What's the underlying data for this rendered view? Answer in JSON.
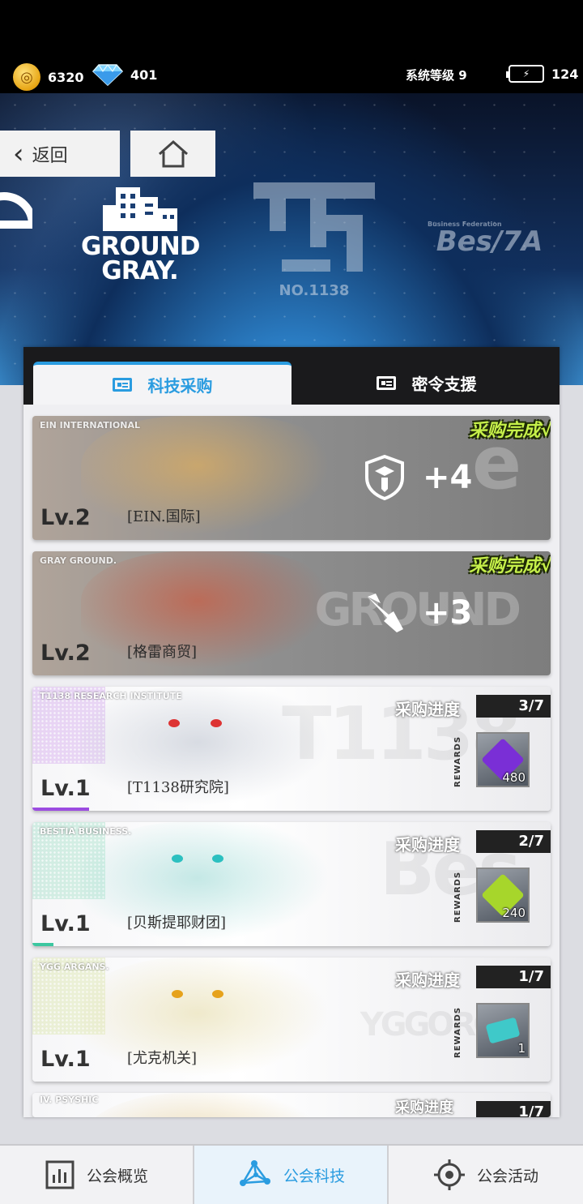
{
  "topbar": {
    "coins": "6320",
    "gems": "401",
    "system_level": "系统等级 9",
    "energy": "124"
  },
  "nav": {
    "back_label": "返回"
  },
  "banner": {
    "logo_gray_line1": "GROUND",
    "logo_gray_line2": "GRAY.",
    "logo_t1138": "NO.1138",
    "logo_bes_small": "Business Federation",
    "logo_bes": "Bes/7A"
  },
  "tabs": [
    {
      "label": "科技采购",
      "active": true
    },
    {
      "label": "密令支援",
      "active": false
    }
  ],
  "cards": [
    {
      "tag": "EIN INTERNATIONAL",
      "level": "Lv.2",
      "name": "[EIN.国际]",
      "status": "采购完成√",
      "bonus": "+4",
      "bonus_icon": "shield-icon"
    },
    {
      "tag": "GRAY GROUND.",
      "level": "Lv.2",
      "name": "[格雷商贸]",
      "status": "采购完成√",
      "bonus": "+3",
      "bonus_icon": "blade-icon"
    },
    {
      "tag": "T1138 RESEARCH INSTITUTE",
      "level": "Lv.1",
      "name": "[T1138研究院]",
      "progress_label": "采购进度",
      "progress": "3/7",
      "rewards_label": "REWARDS",
      "reward_qty": "480",
      "reward_color": "#7a2fd6",
      "bar_color": "#9b4be0",
      "bar_fraction": 0.11
    },
    {
      "tag": "BESTIA BUSINESS.",
      "level": "Lv.1",
      "name": "[贝斯提耶财团]",
      "progress_label": "采购进度",
      "progress": "2/7",
      "rewards_label": "REWARDS",
      "reward_qty": "240",
      "reward_color": "#a7d62b",
      "bar_color": "#3cc7a0",
      "bar_fraction": 0.04
    },
    {
      "tag": "YGG ARGANS.",
      "level": "Lv.1",
      "name": "[尤克机关]",
      "progress_label": "采购进度",
      "progress": "1/7",
      "rewards_label": "REWARDS",
      "reward_qty": "1",
      "reward_color": "#3fc9c9"
    },
    {
      "tag": "IV. PSYSHIC",
      "progress_label": "采购进度",
      "progress": "1/7"
    }
  ],
  "bottom_nav": [
    {
      "label": "公会概览",
      "icon": "chart-icon",
      "active": false
    },
    {
      "label": "公会科技",
      "icon": "network-icon",
      "active": true
    },
    {
      "label": "公会活动",
      "icon": "target-icon",
      "active": false
    }
  ]
}
